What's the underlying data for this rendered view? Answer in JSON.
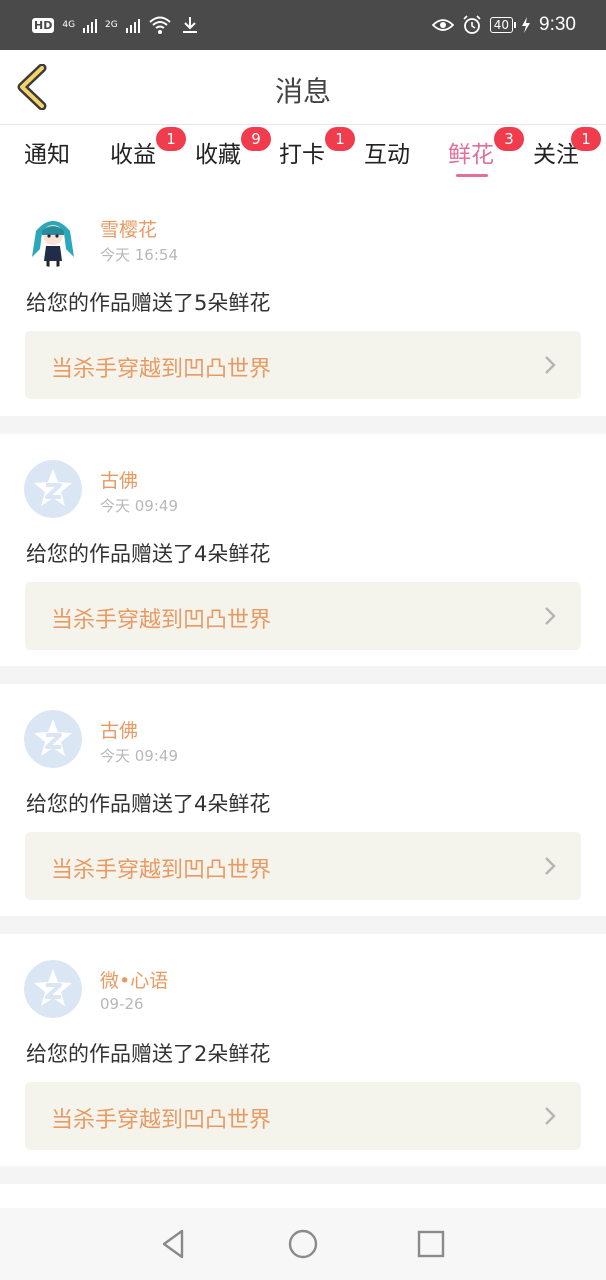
{
  "status_bar": {
    "hd": "HD",
    "net1": "4G",
    "net2": "2G",
    "battery": "40",
    "time": "9:30"
  },
  "header": {
    "title": "消息"
  },
  "tabs": [
    {
      "label": "通知",
      "badge": ""
    },
    {
      "label": "收益",
      "badge": "1"
    },
    {
      "label": "收藏",
      "badge": "9"
    },
    {
      "label": "打卡",
      "badge": "1"
    },
    {
      "label": "互动",
      "badge": ""
    },
    {
      "label": "鲜花",
      "badge": "3",
      "active": true
    },
    {
      "label": "关注",
      "badge": "1"
    }
  ],
  "messages": [
    {
      "name": "雪樱花",
      "time": "今天 16:54",
      "text": "给您的作品赠送了5朵鲜花",
      "work": "当杀手穿越到凹凸世界",
      "avatar": "anime-avatar-icon"
    },
    {
      "name": "古佛",
      "time": "今天 09:49",
      "text": "给您的作品赠送了4朵鲜花",
      "work": "当杀手穿越到凹凸世界",
      "avatar": "default-avatar-icon"
    },
    {
      "name": "古佛",
      "time": "今天 09:49",
      "text": "给您的作品赠送了4朵鲜花",
      "work": "当杀手穿越到凹凸世界",
      "avatar": "default-avatar-icon"
    },
    {
      "name": "微•心语",
      "time": "09-26",
      "text": "给您的作品赠送了2朵鲜花",
      "work": "当杀手穿越到凹凸世界",
      "avatar": "default-avatar-icon"
    }
  ],
  "colors": {
    "accent": "#e0709a",
    "name": "#e89a63",
    "badge": "#f03c4d"
  }
}
